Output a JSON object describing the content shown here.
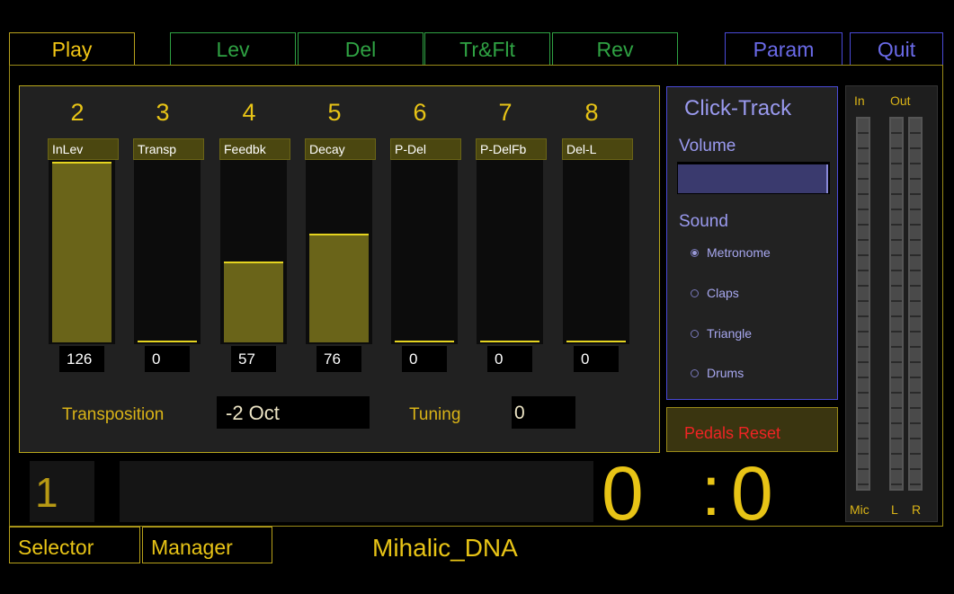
{
  "tabs": {
    "play": "Play",
    "lev": "Lev",
    "del": "Del",
    "trflt": "Tr&Flt",
    "rev": "Rev",
    "param": "Param",
    "quit": "Quit"
  },
  "channels": [
    {
      "number": "2",
      "label": "InLev",
      "value": "126",
      "level": 1.0
    },
    {
      "number": "3",
      "label": "Transp",
      "value": "0",
      "level": 0.0
    },
    {
      "number": "4",
      "label": "Feedbk",
      "value": "57",
      "level": 0.45
    },
    {
      "number": "5",
      "label": "Decay",
      "value": "76",
      "level": 0.6
    },
    {
      "number": "6",
      "label": "P-Del",
      "value": "0",
      "level": 0.0
    },
    {
      "number": "7",
      "label": "P-DelFb",
      "value": "0",
      "level": 0.0
    },
    {
      "number": "8",
      "label": "Del-L",
      "value": "0",
      "level": 0.0
    }
  ],
  "transposition": {
    "label": "Transposition",
    "value": "-2 Oct"
  },
  "tuning": {
    "label": "Tuning",
    "value": "0"
  },
  "click_track": {
    "title": "Click-Track",
    "volume_label": "Volume",
    "sound_label": "Sound",
    "options": [
      {
        "label": "Metronome",
        "selected": true
      },
      {
        "label": "Claps",
        "selected": false
      },
      {
        "label": "Triangle",
        "selected": false
      },
      {
        "label": "Drums",
        "selected": false
      }
    ]
  },
  "pedals_reset": "Pedals Reset",
  "meters": {
    "in": "In",
    "out": "Out",
    "mic": "Mic",
    "l": "L",
    "r": "R"
  },
  "status": {
    "number": "1",
    "time_left": "0",
    "time_sep": ":",
    "time_right": "0"
  },
  "bottom": {
    "selector": "Selector",
    "manager": "Manager",
    "preset_name": "Mihalic_DNA"
  },
  "colors": {
    "accent": "#e8c416",
    "tab_green": "#2fa243",
    "tab_blue": "#4a4ad8",
    "pedals_text": "#ef2424"
  }
}
